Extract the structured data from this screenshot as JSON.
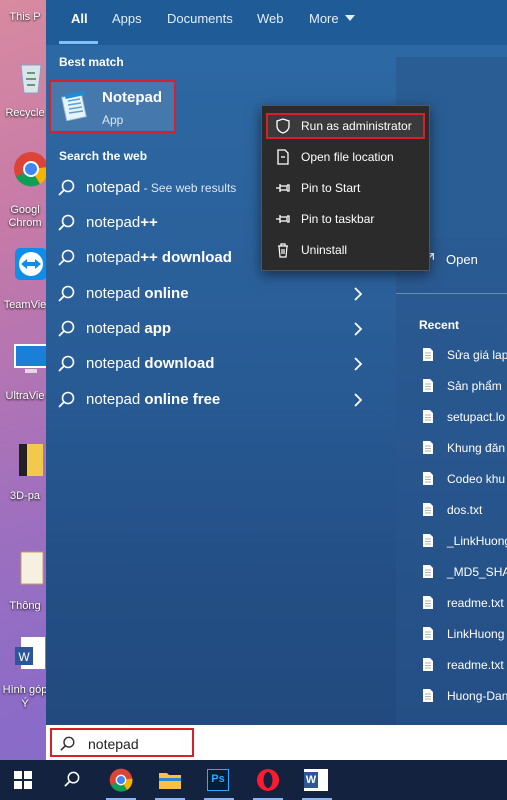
{
  "desktop": {
    "icons": [
      {
        "label": "This P"
      },
      {
        "label": "Recycle"
      },
      {
        "label": "Googl Chrom"
      },
      {
        "label": "TeamVie"
      },
      {
        "label": "UltraVie"
      },
      {
        "label": "3D-pa"
      },
      {
        "label": "Thông"
      },
      {
        "label": "Hình góp Ý"
      }
    ]
  },
  "tabs": {
    "all": "All",
    "apps": "Apps",
    "documents": "Documents",
    "web": "Web",
    "more": "More"
  },
  "best_match": {
    "heading": "Best match",
    "name": "Notepad",
    "type": "App"
  },
  "search_web": {
    "heading": "Search the web",
    "items": [
      {
        "prefix": "notepad",
        "bold": "",
        "sub": " - See web results",
        "chevron": false
      },
      {
        "prefix": "notepad",
        "bold": "++",
        "sub": "",
        "chevron": false
      },
      {
        "prefix": "notepad",
        "bold": "++ download",
        "sub": "",
        "chevron": false
      },
      {
        "prefix": "notepad",
        "bold": " online",
        "sub": "",
        "chevron": true
      },
      {
        "prefix": "notepad",
        "bold": " app",
        "sub": "",
        "chevron": true
      },
      {
        "prefix": "notepad",
        "bold": " download",
        "sub": "",
        "chevron": true
      },
      {
        "prefix": "notepad",
        "bold": " online free",
        "sub": "",
        "chevron": true
      }
    ]
  },
  "context_menu": {
    "items": [
      {
        "label": "Run as administrator",
        "icon": "shield-icon",
        "highlighted": true
      },
      {
        "label": "Open file location",
        "icon": "file-location-icon",
        "highlighted": false
      },
      {
        "label": "Pin to Start",
        "icon": "pin-icon",
        "highlighted": false
      },
      {
        "label": "Pin to taskbar",
        "icon": "pin-icon",
        "highlighted": false
      },
      {
        "label": "Uninstall",
        "icon": "trash-icon",
        "highlighted": false
      }
    ]
  },
  "preview": {
    "open_label": "Open",
    "recent_heading": "Recent",
    "recent_items": [
      "Sửa giá lap",
      "Sản phẩm",
      "setupact.lo",
      "Khung đăn",
      "Codeo khu",
      "dos.txt",
      "_LinkHuong",
      "_MD5_SHA",
      "readme.txt",
      "LinkHuong",
      "readme.txt",
      "Huong-Dan"
    ]
  },
  "search": {
    "value": "notepad"
  },
  "taskbar": {
    "items": [
      "windows-start-icon",
      "search-icon",
      "chrome-icon",
      "file-explorer-icon",
      "photoshop-icon",
      "opera-icon",
      "word-icon"
    ],
    "photoshop_label": "Ps",
    "word_label": "W"
  },
  "colors": {
    "highlight_red": "#d9202a",
    "menu_blue": "#2a5f99",
    "taskbar": "#13233f"
  }
}
